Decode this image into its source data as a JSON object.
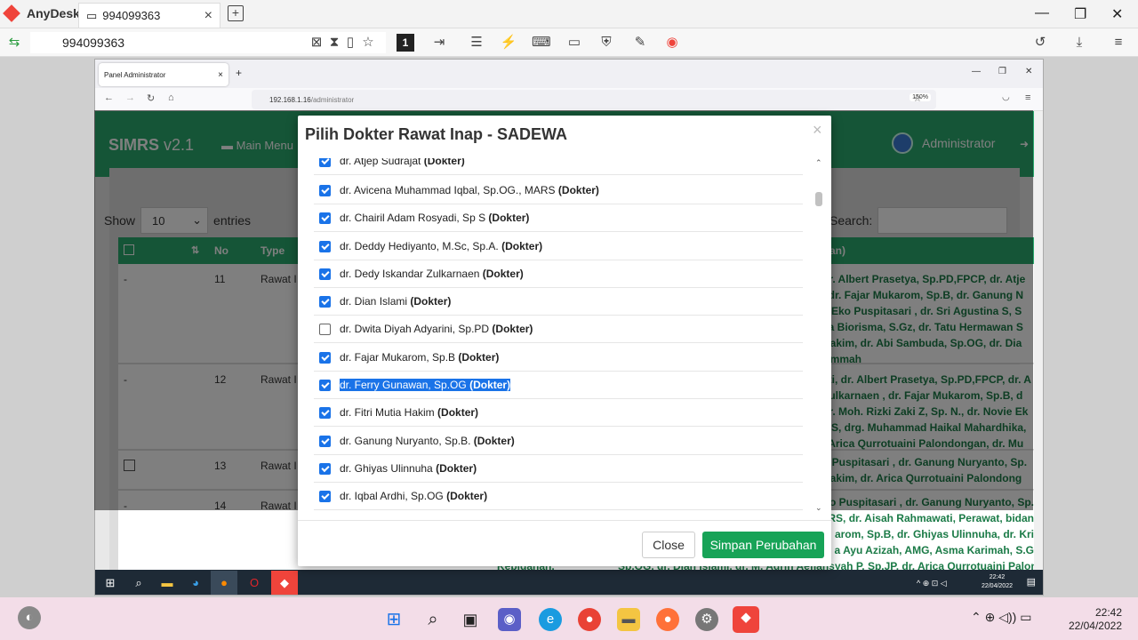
{
  "anydesk": {
    "app_name": "AnyDesk",
    "tab_label": "994099363",
    "address": "994099363"
  },
  "remote_browser": {
    "tab_title": "Panel Administrator",
    "url_host": "192.168.1.16",
    "url_path": "/administrator",
    "zoom": "150%"
  },
  "page": {
    "brand": "SIMRS",
    "version": "v2.1",
    "main_menu": "Main Menu",
    "user": "Administrator",
    "show_label": "Show",
    "entries_value": "10",
    "entries_label": "entries",
    "search_label": "Search:",
    "columns": {
      "no": "No",
      "type": "Type",
      "last": "an)"
    },
    "rows": [
      {
        "check": "-",
        "no": "11",
        "type": "Rawat I",
        "lines": [
          "dr. Albert Prasetya, Sp.PD,FPCP, dr. Atje",
          ", dr. Fajar Mukarom, Sp.B, dr. Ganung N",
          "e Eko Puspitasari , dr. Sri Agustina S, S",
          "lia Biorisma, S.Gz, dr. Tatu Hermawan S",
          "Hakim, dr. Abi Sambuda, Sp.OG, dr. Dia",
          "Ummah"
        ]
      },
      {
        "check": "-",
        "no": "12",
        "type": "Rawat I",
        "lines": [
          "ati, dr. Albert Prasetya, Sp.PD,FPCP, dr. A",
          "Zulkarnaen , dr. Fajar Mukarom, Sp.B, d",
          "dr. Moh. Rizki Zaki Z, Sp. N., dr. Novie Ek",
          "a S, drg. Muhammad Haikal Mahardhika,",
          ". Arica Qurrotuaini Palondongan, dr. Mu"
        ]
      },
      {
        "check": "",
        "no": "13",
        "type": "Rawat I",
        "lines": [
          "o Puspitasari , dr. Ganung Nuryanto, Sp.",
          "Hakim, dr. Arica Qurrotuaini Palondong"
        ]
      },
      {
        "check": "-",
        "no": "14",
        "type": "Rawat I",
        "lines": [
          "o Puspitasari , dr. Ganung Nuryanto, Sp.",
          "RS, dr. Aisah Rahmawati, Perawat, bidan",
          "arom, Sp.B, dr. Ghiyas Ulinnuha, dr. Kri",
          "a Ayu Azizah, AMG, Asma Karimah, S.G",
          "Sp.OG, dr. Dian Islami, dr. M. Adrin Aefiansyah P, Sp.JP, dr. Arica Qurrotuaini Palon"
        ]
      }
    ],
    "row14_left": "Kebidanan,"
  },
  "modal": {
    "title": "Pilih Dokter Rawat Inap - SADEWA",
    "close_x": "×",
    "items": [
      {
        "name": "dr. Atjep Sudrajat",
        "role": "(Dokter)",
        "checked": true
      },
      {
        "name": "dr. Avicena Muhammad Iqbal, Sp.OG., MARS",
        "role": "(Dokter)",
        "checked": true
      },
      {
        "name": "dr. Chairil Adam Rosyadi, Sp S",
        "role": "(Dokter)",
        "checked": true
      },
      {
        "name": "dr. Deddy Hediyanto, M.Sc, Sp.A.",
        "role": "(Dokter)",
        "checked": true
      },
      {
        "name": "dr. Dedy Iskandar Zulkarnaen",
        "role": "(Dokter)",
        "checked": true
      },
      {
        "name": "dr. Dian Islami",
        "role": "(Dokter)",
        "checked": true
      },
      {
        "name": "dr. Dwita Diyah Adyarini, Sp.PD",
        "role": "(Dokter)",
        "checked": false
      },
      {
        "name": "dr. Fajar Mukarom, Sp.B",
        "role": "(Dokter)",
        "checked": true
      },
      {
        "name": "dr. Ferry Gunawan, Sp.OG",
        "role": "(Dokter)",
        "checked": true,
        "selected": true
      },
      {
        "name": "dr. Fitri Mutia Hakim",
        "role": "(Dokter)",
        "checked": true
      },
      {
        "name": "dr. Ganung Nuryanto, Sp.B.",
        "role": "(Dokter)",
        "checked": true
      },
      {
        "name": "dr. Ghiyas Ulinnuha",
        "role": "(Dokter)",
        "checked": true
      },
      {
        "name": "dr. Iqbal Ardhi, Sp.OG",
        "role": "(Dokter)",
        "checked": true
      }
    ],
    "close_button": "Close",
    "save_button": "Simpan Perubahan"
  },
  "remote_taskbar": {
    "time": "22:42",
    "date": "22/04/2022"
  },
  "local_taskbar": {
    "time": "22:42",
    "date": "22/04/2022"
  },
  "colors": {
    "accent_green": "#2bab6e",
    "save_green": "#17a357",
    "check_blue": "#1a73e8",
    "anydesk_red": "#ef443b"
  }
}
